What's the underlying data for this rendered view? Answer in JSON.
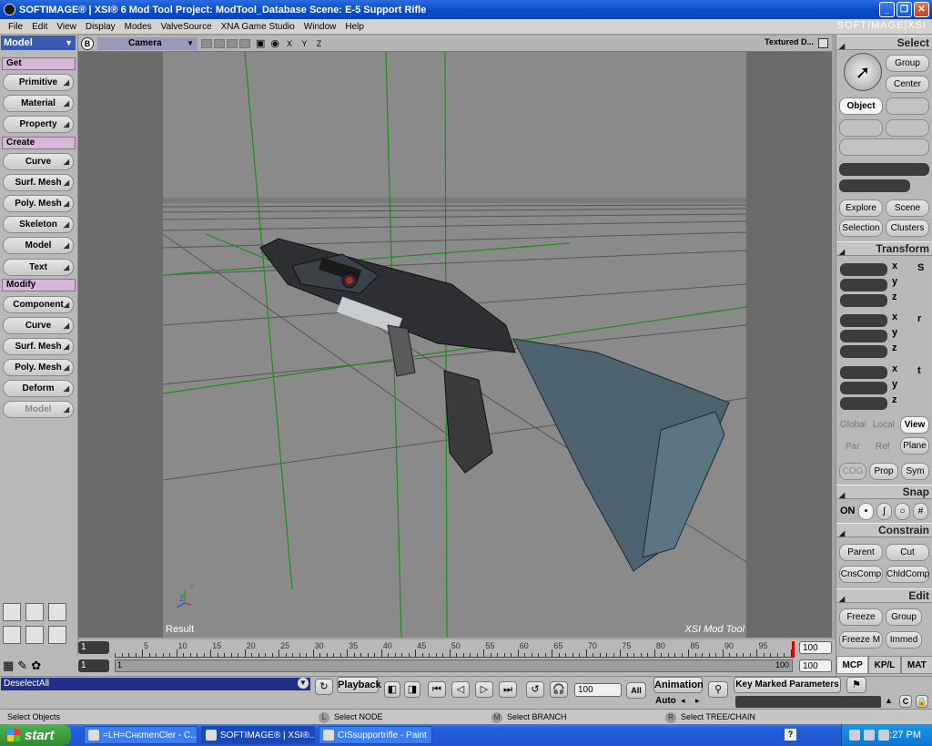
{
  "window": {
    "title": "SOFTIMAGE® | XSI® 6 Mod Tool Project: ModTool_Database     Scene: E-5 Support Rifle",
    "brand": "SOFTIMAGE|XSI"
  },
  "menu": [
    "File",
    "Edit",
    "View",
    "Display",
    "Modes",
    "ValveSource",
    "XNA Game Studio",
    "Window",
    "Help"
  ],
  "left_toolbar": {
    "mode": "Model",
    "sections": {
      "get": "Get",
      "create": "Create",
      "modify": "Modify"
    },
    "get_items": [
      "Primitive",
      "Material",
      "Property"
    ],
    "create_items": [
      "Curve",
      "Surf. Mesh",
      "Poly. Mesh",
      "Skeleton",
      "Model",
      "Text"
    ],
    "modify_items": [
      "Component",
      "Curve",
      "Surf. Mesh",
      "Poly. Mesh",
      "Deform",
      "Model"
    ]
  },
  "viewport": {
    "letter": "B",
    "camera": "Camera",
    "axes": "X Y Z",
    "shading": "Textured D...",
    "label_left": "Result",
    "label_right": "XSI Mod Tool",
    "gizmo_y": "Y",
    "gizmo_z": "Z"
  },
  "right_panel": {
    "select_hdr": "Select",
    "group": "Group",
    "center": "Center",
    "object": "Object",
    "explore": "Explore",
    "scene": "Scene",
    "selection": "Selection",
    "clusters": "Clusters",
    "transform_hdr": "Transform",
    "axis_x": "x",
    "axis_y": "y",
    "axis_z": "z",
    "trs_s": "S",
    "trs_r": "r",
    "trs_t": "t",
    "global": "Global",
    "local": "Local",
    "view": "View",
    "par": "Par",
    "ref": "Ref",
    "plane": "Plane",
    "cog": "COG",
    "prop": "Prop",
    "sym": "Sym",
    "snap_hdr": "Snap",
    "snap_on": "ON",
    "constrain_hdr": "Constrain",
    "parent": "Parent",
    "cut": "Cut",
    "cnscomp": "CnsComp",
    "chldcomp": "ChldComp",
    "edit_hdr": "Edit",
    "freeze": "Freeze",
    "edit_group": "Group",
    "freeze_m": "Freeze M",
    "immed": "Immed",
    "tabs": [
      "MCP",
      "KP/L",
      "MAT"
    ]
  },
  "timeline": {
    "start_frame": "1",
    "range_start": "1",
    "range_start_label": "1",
    "end_frame": "100",
    "range_end": "100",
    "range_end_label": "100",
    "ticks": [
      "5",
      "10",
      "15",
      "20",
      "25",
      "30",
      "35",
      "40",
      "45",
      "50",
      "55",
      "60",
      "65",
      "70",
      "75",
      "80",
      "85",
      "90",
      "95"
    ]
  },
  "playback": {
    "command": "DeselectAll",
    "playback_label": "Playback",
    "frame_value": "100",
    "all_label": "All",
    "animation_label": "Animation",
    "auto_label": "Auto",
    "key_marked": "Key Marked Parameters"
  },
  "status": {
    "left": "Select Objects",
    "l_badge": "L",
    "l_text": "Select NODE",
    "m_badge": "M",
    "m_text": "Select BRANCH",
    "r_badge": "R",
    "r_text": "Select TREE/CHAIN"
  },
  "taskbar": {
    "start": "start",
    "tasks": [
      "=LH=CнєmenCler - C...",
      "SOFTIMAGE® | XSI®...",
      "CISsupportrifle - Paint"
    ],
    "clock": "9:27 PM"
  }
}
